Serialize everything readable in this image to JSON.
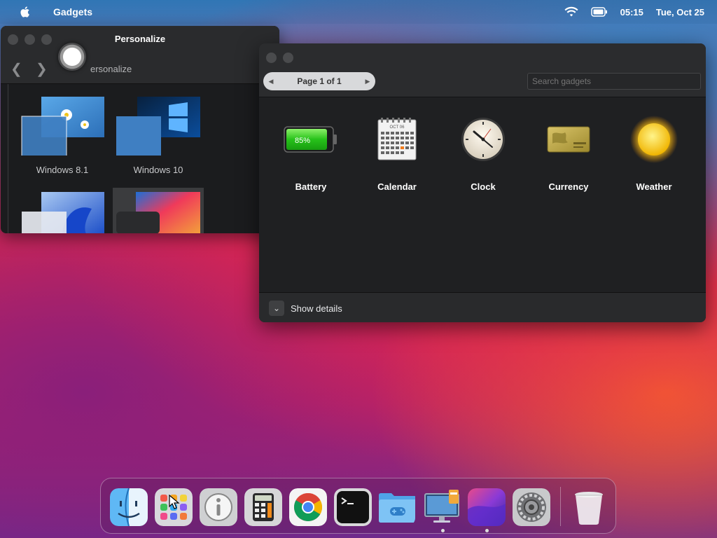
{
  "menubar": {
    "app_name": "Gadgets",
    "time": "05:15",
    "date": "Tue, Oct 25"
  },
  "personalize": {
    "title": "Personalize",
    "breadcrumb": "ersonalize",
    "themes": [
      {
        "label": "Windows 8.1"
      },
      {
        "label": "Windows 10"
      },
      {
        "label": ""
      },
      {
        "label": ""
      }
    ]
  },
  "gadgets": {
    "pager_text": "Page 1 of 1",
    "search_placeholder": "Search gadgets",
    "items": [
      {
        "name": "Battery",
        "icon": "battery-gadget-icon",
        "level": "85%"
      },
      {
        "name": "Calendar",
        "icon": "calendar-gadget-icon",
        "month": "OCT 06"
      },
      {
        "name": "Clock",
        "icon": "clock-gadget-icon"
      },
      {
        "name": "Currency",
        "icon": "currency-gadget-icon"
      },
      {
        "name": "Weather",
        "icon": "weather-gadget-icon"
      }
    ],
    "show_details": "Show details"
  },
  "dock": {
    "items": [
      {
        "name": "finder",
        "icon": "finder-icon"
      },
      {
        "name": "launchpad",
        "icon": "launchpad-icon"
      },
      {
        "name": "info",
        "icon": "info-icon"
      },
      {
        "name": "calculator",
        "icon": "calculator-icon"
      },
      {
        "name": "chrome",
        "icon": "chrome-icon"
      },
      {
        "name": "terminal",
        "icon": "terminal-icon"
      },
      {
        "name": "games-folder",
        "icon": "folder-icon"
      },
      {
        "name": "desktop-gadgets",
        "icon": "desktop-icon"
      },
      {
        "name": "wallpaper",
        "icon": "wallpaper-icon"
      },
      {
        "name": "system-preferences",
        "icon": "settings-icon"
      },
      {
        "name": "trash",
        "icon": "trash-icon"
      }
    ]
  },
  "colors": {
    "accent_blue": "#3a86c9",
    "accent_red": "#e8264d",
    "window_bg": "#1f2022"
  }
}
